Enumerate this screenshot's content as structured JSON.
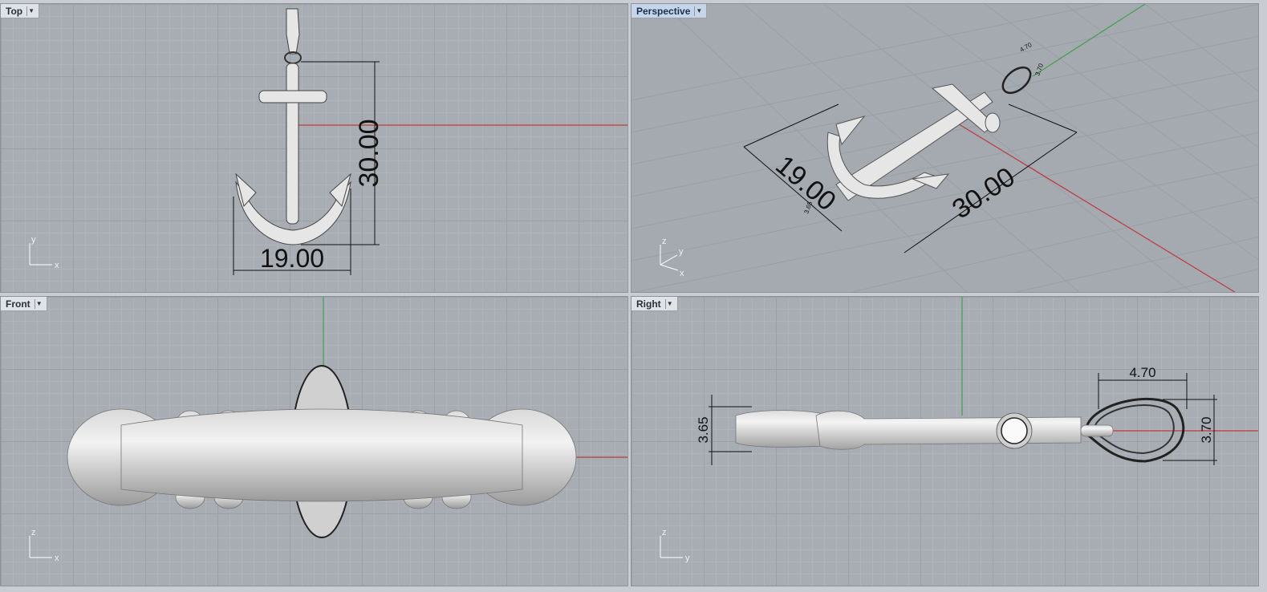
{
  "viewports": {
    "top": {
      "title": "Top",
      "dim_height": "30.00",
      "dim_width": "19.00",
      "axis1": "y",
      "axis2": "x"
    },
    "perspective": {
      "title": "Perspective",
      "dim_left": "19.00",
      "dim_right": "30.00",
      "dim_small1": "4.70",
      "dim_small2": "3.70",
      "dim_small3": "3.65",
      "axis1": "z",
      "axis2": "y",
      "axis3": "x"
    },
    "front": {
      "title": "Front",
      "axis1": "z",
      "axis2": "x"
    },
    "right": {
      "title": "Right",
      "dim_width": "4.70",
      "dim_left": "3.65",
      "dim_right": "3.70",
      "axis1": "z",
      "axis2": "y"
    }
  },
  "colors": {
    "x_axis": "#c0393b",
    "y_axis": "#3fa34a",
    "model": "#e4e4e4",
    "grid": "#a8acb3"
  },
  "icons": {
    "tab_menu": "chevron-down-icon"
  }
}
